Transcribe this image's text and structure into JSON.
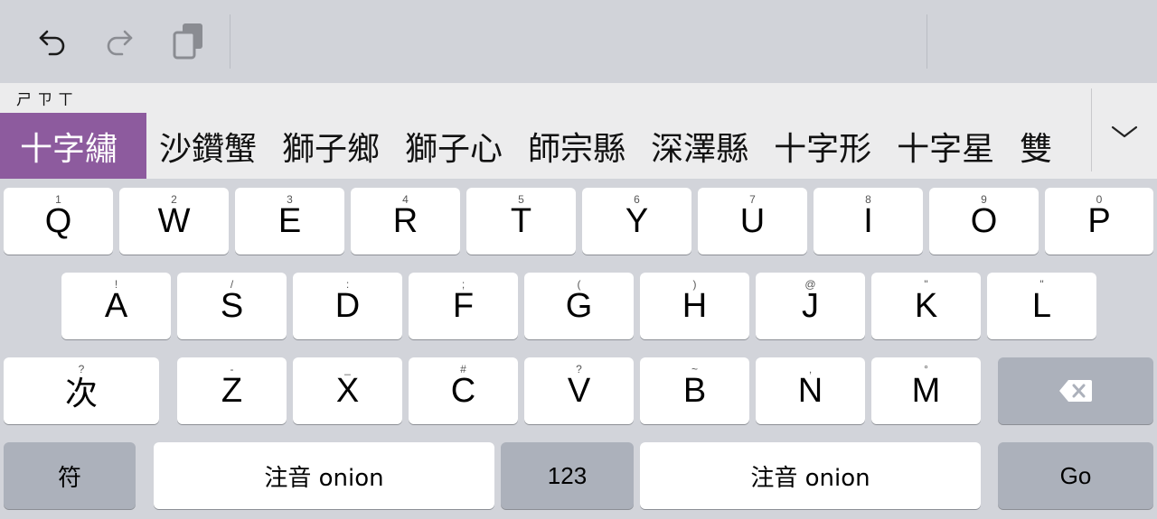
{
  "toolbar": {
    "buttons": [
      {
        "name": "undo-button",
        "icon": "undo-icon"
      },
      {
        "name": "redo-button",
        "icon": "redo-icon"
      },
      {
        "name": "clipboard-button",
        "icon": "clipboard-icon"
      }
    ]
  },
  "candidate_bar": {
    "phonetic": "ㄕㄗㄒ",
    "candidates": [
      "十字繡",
      "沙鑽蟹",
      "獅子鄉",
      "獅子心",
      "師宗縣",
      "深澤縣",
      "十字形",
      "十字星",
      "雙"
    ],
    "selected_index": 0,
    "expand_icon": "chevron-down-icon"
  },
  "keyboard": {
    "row1": [
      {
        "key": "Q",
        "hint": "1"
      },
      {
        "key": "W",
        "hint": "2"
      },
      {
        "key": "E",
        "hint": "3"
      },
      {
        "key": "R",
        "hint": "4"
      },
      {
        "key": "T",
        "hint": "5"
      },
      {
        "key": "Y",
        "hint": "6"
      },
      {
        "key": "U",
        "hint": "7"
      },
      {
        "key": "I",
        "hint": "8"
      },
      {
        "key": "O",
        "hint": "9"
      },
      {
        "key": "P",
        "hint": "0"
      }
    ],
    "row2": [
      {
        "key": "A",
        "hint": "!"
      },
      {
        "key": "S",
        "hint": "/"
      },
      {
        "key": "D",
        "hint": ":"
      },
      {
        "key": "F",
        "hint": ";"
      },
      {
        "key": "G",
        "hint": "("
      },
      {
        "key": "H",
        "hint": ")"
      },
      {
        "key": "J",
        "hint": "@"
      },
      {
        "key": "K",
        "hint": "\""
      },
      {
        "key": "L",
        "hint": "\""
      }
    ],
    "row3": [
      {
        "key": "次",
        "hint": "?"
      },
      {
        "key": "Z",
        "hint": "-"
      },
      {
        "key": "X",
        "hint": "_"
      },
      {
        "key": "C",
        "hint": "#"
      },
      {
        "key": "V",
        "hint": "?"
      },
      {
        "key": "B",
        "hint": "~"
      },
      {
        "key": "N",
        "hint": ","
      },
      {
        "key": "M",
        "hint": "°"
      }
    ],
    "backspace_icon": "backspace-icon",
    "row4": {
      "symbols": "符",
      "space_left": "注音 onion",
      "numbers": "123",
      "space_right": "注音 onion",
      "go": "Go"
    }
  },
  "colors": {
    "accent": "#8d5b9e",
    "background": "#d2d4da",
    "candidate_bar": "#ececed",
    "key": "#ffffff",
    "dark_key": "#acb1bb"
  }
}
